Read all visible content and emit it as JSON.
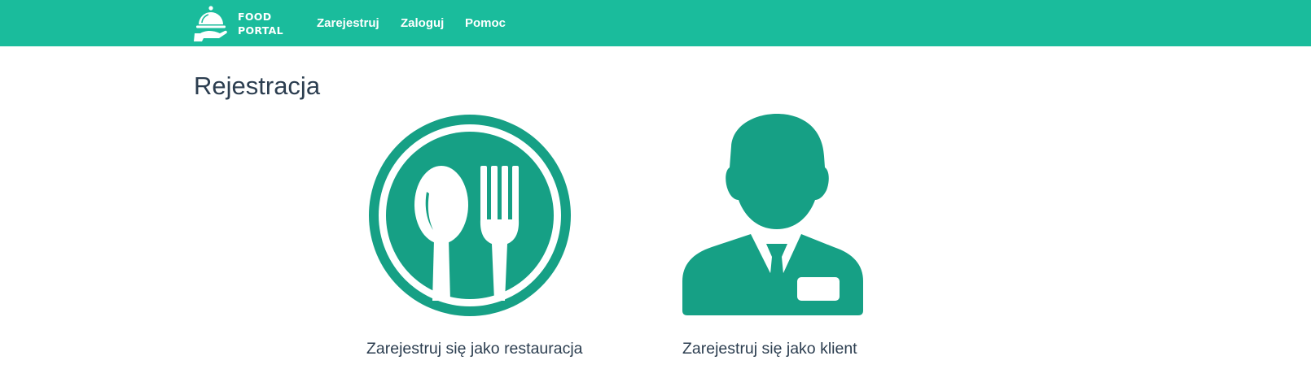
{
  "navbar": {
    "brand_line1": "FOOD",
    "brand_line2": "PORTAL",
    "links": {
      "register": "Zarejestruj",
      "login": "Zaloguj",
      "help": "Pomoc"
    }
  },
  "page": {
    "title": "Rejestracja"
  },
  "options": {
    "restaurant": {
      "label": "Zarejestruj się jako restauracja",
      "icon": "plate-spoon-fork-icon"
    },
    "client": {
      "label": "Zarejestruj się jako klient",
      "icon": "person-with-badge-icon"
    }
  },
  "colors": {
    "navbar": "#1abc9c",
    "icon": "#16a085",
    "text": "#2c3e50",
    "nav_text": "#ffffff"
  }
}
